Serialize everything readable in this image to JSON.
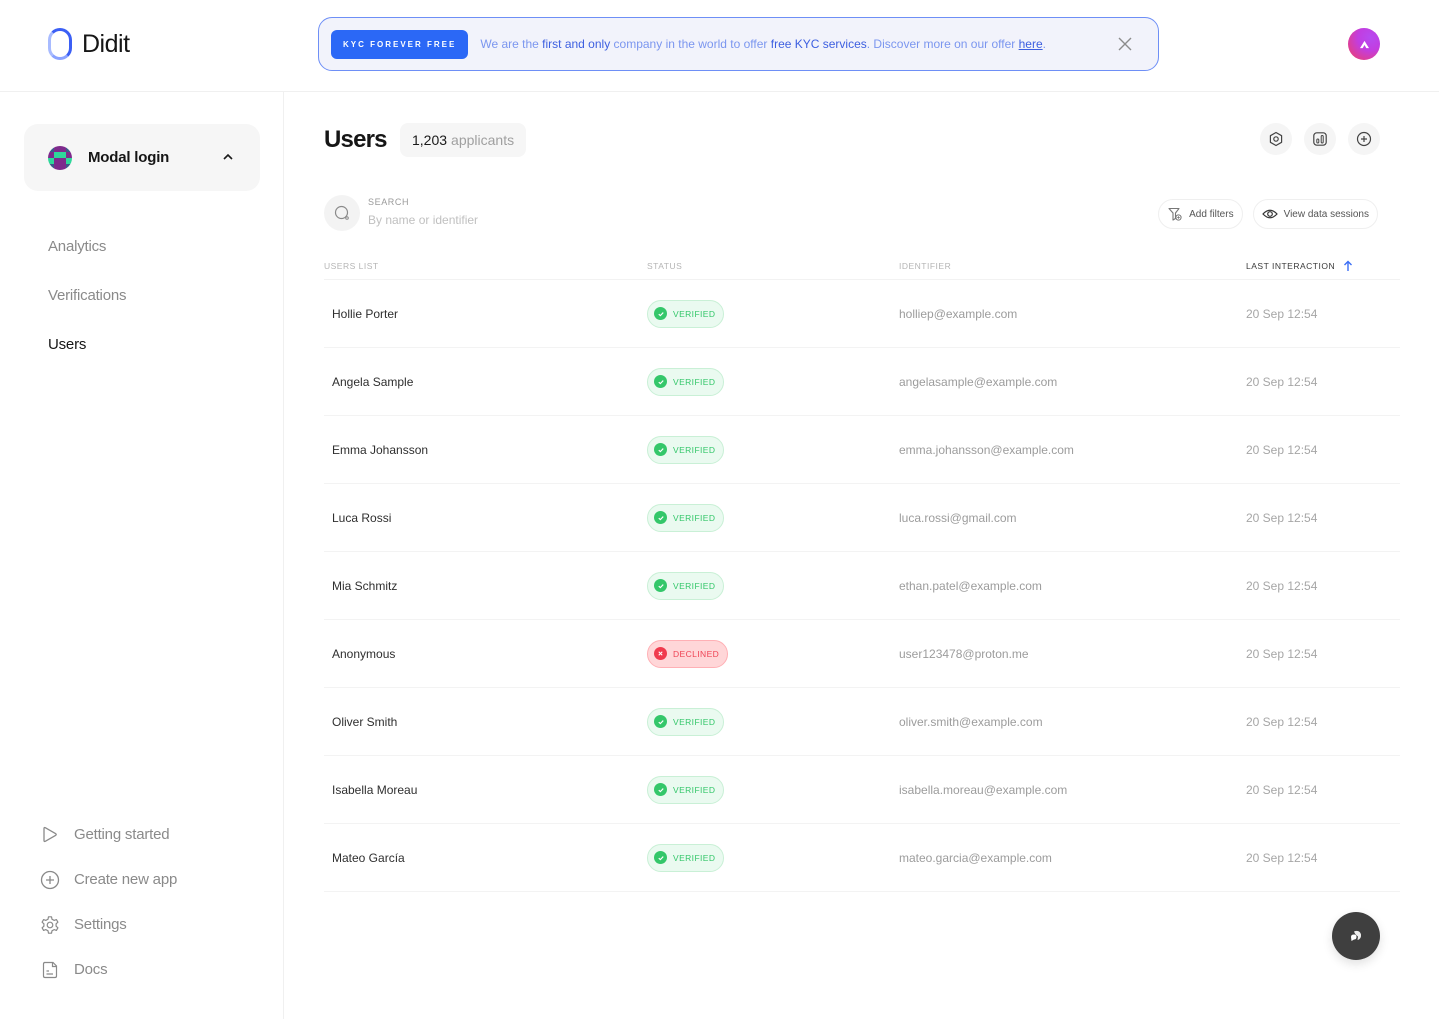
{
  "header": {
    "brand": "Didit",
    "banner": {
      "badge": "KYC FOREVER FREE",
      "text_1": "We are the ",
      "text_em_1": "first and only",
      "text_2": " company in the world to offer ",
      "text_em_2": "free KYC services",
      "text_3": ". Discover more on our offer ",
      "link": "here",
      "text_4": "."
    },
    "colors": {
      "accent": "#2b68f6",
      "banner_border": "#6e8ff6"
    }
  },
  "sidebar": {
    "app_switcher": {
      "name": "Modal login",
      "expanded": true
    },
    "nav": [
      {
        "label": "Analytics",
        "active": false
      },
      {
        "label": "Verifications",
        "active": false
      },
      {
        "label": "Users",
        "active": true
      }
    ],
    "bottom": [
      {
        "label": "Getting started",
        "icon": "play-icon"
      },
      {
        "label": "Create new app",
        "icon": "plus-circle-icon"
      },
      {
        "label": "Settings",
        "icon": "gear-icon"
      },
      {
        "label": "Docs",
        "icon": "document-icon"
      }
    ]
  },
  "main": {
    "title": "Users",
    "count": "1,203",
    "count_label": "applicants",
    "search": {
      "label": "SEARCH",
      "placeholder": "By name or identifier",
      "value": ""
    },
    "actions": {
      "add_filters": "Add filters",
      "view_sessions": "View data sessions"
    },
    "table": {
      "columns": [
        "USERS LIST",
        "STATUS",
        "IDENTIFIER",
        "LAST INTERACTION"
      ],
      "sort": {
        "column": "LAST INTERACTION",
        "direction": "ascending"
      },
      "rows": [
        {
          "name": "Hollie Porter",
          "status": "VERIFIED",
          "identifier": "holliep@example.com",
          "last": "20 Sep 12:54"
        },
        {
          "name": "Angela Sample",
          "status": "VERIFIED",
          "identifier": "angelasample@example.com",
          "last": "20 Sep 12:54"
        },
        {
          "name": "Emma Johansson",
          "status": "VERIFIED",
          "identifier": "emma.johansson@example.com",
          "last": "20 Sep 12:54"
        },
        {
          "name": "Luca Rossi",
          "status": "VERIFIED",
          "identifier": "luca.rossi@gmail.com",
          "last": "20 Sep 12:54"
        },
        {
          "name": "Mia Schmitz",
          "status": "VERIFIED",
          "identifier": "ethan.patel@example.com",
          "last": "20 Sep 12:54"
        },
        {
          "name": "Anonymous",
          "status": "DECLINED",
          "identifier": "user123478@proton.me",
          "last": "20 Sep 12:54"
        },
        {
          "name": "Oliver Smith",
          "status": "VERIFIED",
          "identifier": "oliver.smith@example.com",
          "last": "20 Sep 12:54"
        },
        {
          "name": "Isabella Moreau",
          "status": "VERIFIED",
          "identifier": "isabella.moreau@example.com",
          "last": "20 Sep 12:54"
        },
        {
          "name": "Mateo García",
          "status": "VERIFIED",
          "identifier": "mateo.garcia@example.com",
          "last": "20 Sep 12:54"
        }
      ]
    },
    "status_colors": {
      "verified": "#34c76a",
      "declined": "#ef4455"
    }
  }
}
